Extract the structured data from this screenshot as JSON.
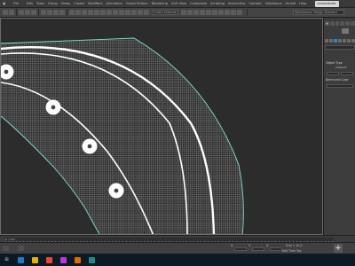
{
  "menubar": {
    "items": [
      "File",
      "Edit",
      "Tools",
      "Group",
      "Views",
      "Create",
      "Modifiers",
      "Animation",
      "Graph Editors",
      "Rendering",
      "Civil View",
      "Customize",
      "Scripting",
      "Interactive",
      "Content",
      "Substance",
      "Arnold",
      "Help"
    ],
    "user": "cosmestudio"
  },
  "toolbar": {
    "selection_set": "Create Selection Set",
    "workspace": "Workspaces: Design Standard"
  },
  "viewport": {
    "background": "#2c2c2c",
    "wire_color": "#ffffff",
    "edge_color": "#7fe0d6"
  },
  "command_panel": {
    "tab_glyph": "+",
    "rollout_object_type": "Object Type",
    "autogrid": "AutoGrid",
    "field1": "",
    "field2": "",
    "rollout_name_color": "Name and Color",
    "name_field": ""
  },
  "timeslider": {
    "frame_label": "0 / 100"
  },
  "statusbar": {
    "addkey": "+",
    "x_label": "X:",
    "y_label": "Y:",
    "z_label": "Z:",
    "grid": "Grid = 10,0",
    "status": "Add Time Tag"
  },
  "taskbar": {
    "clock_time": "",
    "clock_date": ""
  }
}
